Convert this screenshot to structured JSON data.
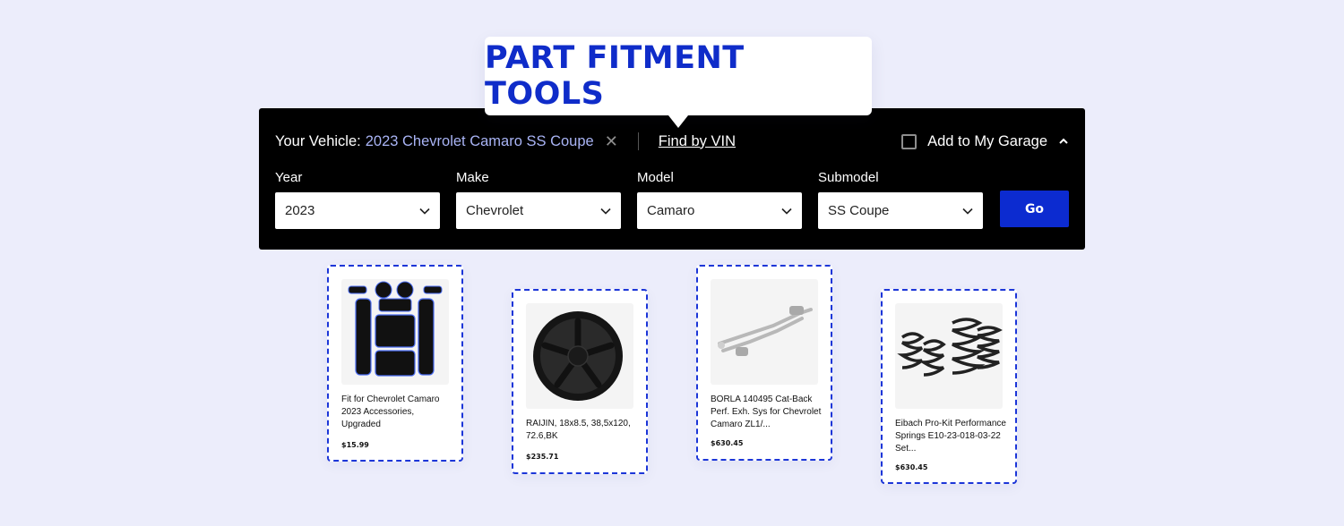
{
  "callout": {
    "title": "PART FITMENT TOOLS"
  },
  "vehicle": {
    "label": "Your Vehicle:",
    "value": "2023 Chevrolet Camaro SS Coupe",
    "find_by_vin": "Find by VIN"
  },
  "garage": {
    "label": "Add to My Garage",
    "checked": false
  },
  "fields": [
    {
      "label": "Year",
      "value": "2023"
    },
    {
      "label": "Make",
      "value": "Chevrolet"
    },
    {
      "label": "Model",
      "value": "Camaro"
    },
    {
      "label": "Submodel",
      "value": "SS Coupe"
    }
  ],
  "go_label": "Go",
  "products": [
    {
      "title": "Fit for Chevrolet Camaro 2023 Accessories, Upgraded",
      "price": "$15.99",
      "icon": "console-liner-mats-icon"
    },
    {
      "title": "RAIJIN, 18x8.5, 38,5x120, 72.6,BK",
      "price": "$235.71",
      "icon": "wheel-icon"
    },
    {
      "title": "BORLA 140495 Cat-Back Perf. Exh. Sys for Chevrolet Camaro ZL1/...",
      "price": "$630.45",
      "icon": "exhaust-system-icon"
    },
    {
      "title": "Eibach Pro-Kit Performance Springs E10-23-018-03-22 Set...",
      "price": "$630.45",
      "icon": "coil-springs-icon"
    }
  ],
  "colors": {
    "background": "#ecedfb",
    "accent": "#0c2bd0",
    "callout_text": "#0f2cc9",
    "vehicle_value": "#a9b4f5",
    "panel": "#000000"
  }
}
